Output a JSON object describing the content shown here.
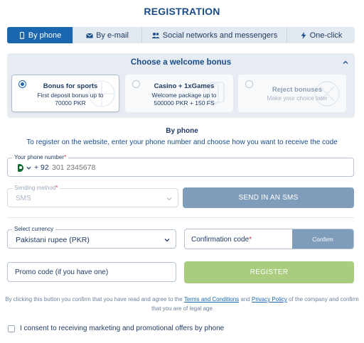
{
  "header": {
    "title": "REGISTRATION"
  },
  "tabs": [
    {
      "label": "By phone",
      "icon": "phone-icon",
      "active": true
    },
    {
      "label": "By e-mail",
      "icon": "envelope-icon",
      "active": false
    },
    {
      "label": "Social networks and messengers",
      "icon": "users-icon",
      "active": false
    },
    {
      "label": "One-click",
      "icon": "lightning-icon",
      "active": false
    }
  ],
  "bonus": {
    "title": "Choose a welcome bonus",
    "options": [
      {
        "title": "Bonus for sports",
        "desc_line1": "First deposit bonus up to",
        "desc_line2": "70000 PKR",
        "selected": true
      },
      {
        "title": "Casino + 1xGames",
        "desc_line1": "Welcome package up to",
        "desc_line2": "500000 PKR + 150 FS",
        "selected": false
      },
      {
        "title": "Reject bonuses",
        "desc_line1": "Make your choice later",
        "desc_line2": "",
        "selected": false
      }
    ]
  },
  "by_phone": {
    "heading": "By phone",
    "subheading": "To register on the website, enter your phone number and choose how you want to receive the code"
  },
  "phone": {
    "label": "Your phone number",
    "required_mark": "*",
    "country_code": "+ 92",
    "placeholder": "301 2345678"
  },
  "sending_method": {
    "label": "Sending method",
    "required_mark": "*",
    "value": "SMS"
  },
  "send_sms_button": "SEND IN AN SMS",
  "currency": {
    "label": "Select currency",
    "value": "Pakistani rupee (PKR)"
  },
  "confirmation": {
    "label": "Confirmation code",
    "required_mark": "*",
    "button": "Confirm"
  },
  "promo": {
    "label": "Promo code (if you have one)"
  },
  "register_button": "REGISTER",
  "legal": {
    "before_terms": "By clicking this button you confirm that you have read and agree to the ",
    "terms_link": "Terms and Conditions",
    "and": " and ",
    "privacy_link": "Privacy Policy",
    "after": " of the company and confirm that you are of legal age"
  },
  "consent": {
    "label": "I consent to receiving marketing and promotional offers by phone"
  },
  "colors": {
    "primary": "#1a67b0",
    "title": "#1a4c8a",
    "button_muted": "#7f9dbb",
    "register_green": "#a9cc7e",
    "panel": "#e6ecf2",
    "required": "#d9343b"
  }
}
